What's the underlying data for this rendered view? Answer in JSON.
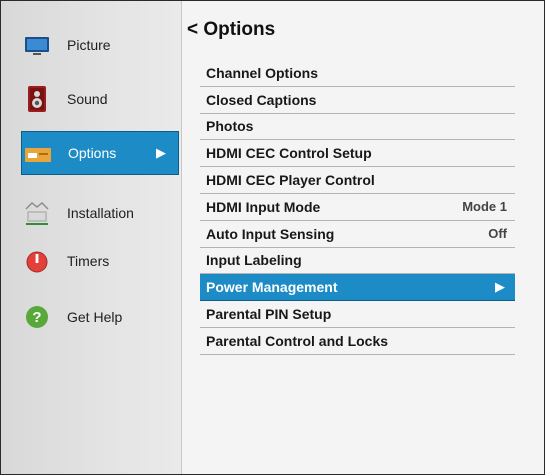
{
  "sidebar": {
    "items": [
      {
        "label": "Picture",
        "icon": "tv-icon"
      },
      {
        "label": "Sound",
        "icon": "speaker-icon"
      },
      {
        "label": "Options",
        "icon": "options-icon",
        "selected": true,
        "arrow": "▶"
      },
      {
        "label": "Installation",
        "icon": "installation-icon"
      },
      {
        "label": "Timers",
        "icon": "power-icon"
      },
      {
        "label": "Get Help",
        "icon": "help-icon"
      }
    ]
  },
  "main": {
    "back_glyph": "<",
    "title": "Options",
    "items": [
      {
        "label": "Channel Options"
      },
      {
        "label": "Closed Captions"
      },
      {
        "label": "Photos"
      },
      {
        "label": "HDMI CEC Control Setup"
      },
      {
        "label": "HDMI CEC Player Control"
      },
      {
        "label": "HDMI Input Mode",
        "value": "Mode 1"
      },
      {
        "label": "Auto Input Sensing",
        "value": "Off"
      },
      {
        "label": "Input Labeling"
      },
      {
        "label": "Power Management",
        "selected": true,
        "arrow": "▶"
      },
      {
        "label": "Parental PIN Setup"
      },
      {
        "label": "Parental Control and Locks"
      }
    ]
  },
  "colors": {
    "accent": "#1d8cc6",
    "accent_border": "#0d5d87"
  }
}
